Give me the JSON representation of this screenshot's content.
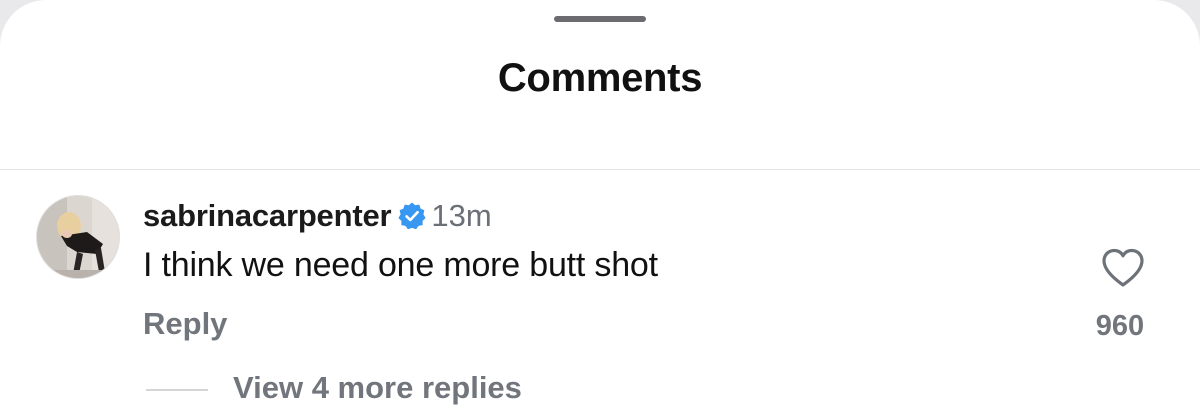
{
  "sheet": {
    "title": "Comments"
  },
  "comment": {
    "username": "sabrinacarpenter",
    "verified": true,
    "time": "13m",
    "text": "I think we need one more butt shot",
    "reply_label": "Reply",
    "like_count": "960",
    "view_replies_label": "View 4 more replies"
  },
  "icons": {
    "verified": "verified-badge-icon",
    "like": "heart-outline-icon"
  },
  "colors": {
    "verified_blue": "#3897f0",
    "secondary_text": "#71757c",
    "primary_text": "#111111"
  }
}
